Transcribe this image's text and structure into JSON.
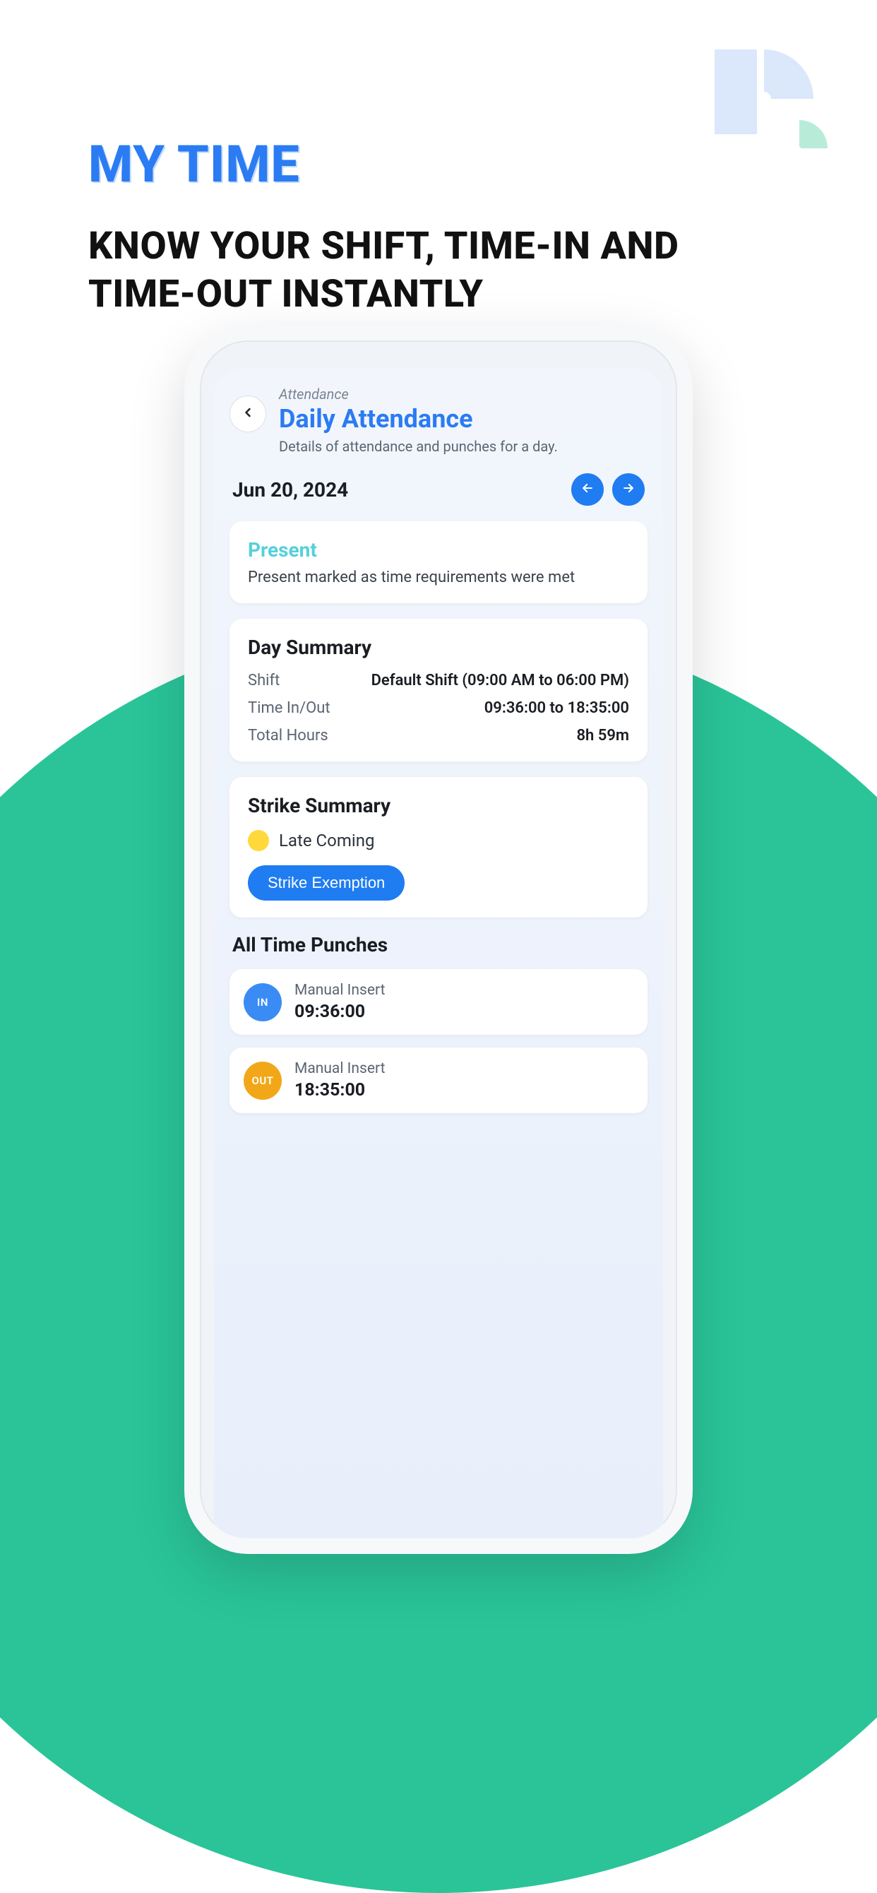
{
  "hero": {
    "title": "MY TIME",
    "subtitle": "KNOW YOUR SHIFT, TIME-IN AND TIME-OUT INSTANTLY"
  },
  "header": {
    "breadcrumb": "Attendance",
    "title": "Daily Attendance",
    "subtitle": "Details of attendance and punches for a day."
  },
  "date": "Jun 20, 2024",
  "status": {
    "label": "Present",
    "description": "Present marked as time requirements were met"
  },
  "day_summary": {
    "title": "Day Summary",
    "rows": [
      {
        "k": "Shift",
        "v": "Default Shift (09:00 AM to 06:00 PM)"
      },
      {
        "k": "Time In/Out",
        "v": "09:36:00 to 18:35:00"
      },
      {
        "k": "Total Hours",
        "v": "8h 59m"
      }
    ]
  },
  "strike_summary": {
    "title": "Strike Summary",
    "item": "Late Coming",
    "button": "Strike Exemption"
  },
  "punches": {
    "title": "All Time Punches",
    "items": [
      {
        "dir": "IN",
        "source": "Manual Insert",
        "time": "09:36:00"
      },
      {
        "dir": "OUT",
        "source": "Manual Insert",
        "time": "18:35:00"
      }
    ]
  }
}
